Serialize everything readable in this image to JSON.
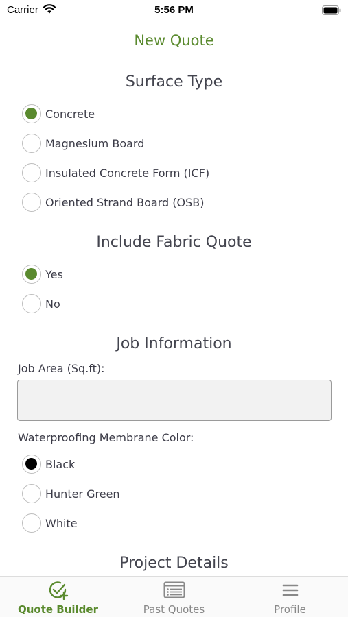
{
  "status_bar": {
    "carrier": "Carrier",
    "time": "5:56 PM"
  },
  "nav": {
    "title": "New Quote"
  },
  "colors": {
    "accent": "#5a8a2e",
    "black_swatch": "#000000"
  },
  "surface_type": {
    "heading": "Surface Type",
    "options": [
      {
        "label": "Concrete",
        "selected": true
      },
      {
        "label": "Magnesium Board",
        "selected": false
      },
      {
        "label": "Insulated Concrete Form (ICF)",
        "selected": false
      },
      {
        "label": "Oriented Strand Board (OSB)",
        "selected": false
      }
    ]
  },
  "fabric_quote": {
    "heading": "Include Fabric Quote",
    "options": [
      {
        "label": "Yes",
        "selected": true
      },
      {
        "label": "No",
        "selected": false
      }
    ]
  },
  "job_info": {
    "heading": "Job Information",
    "job_area_label": "Job Area (Sq.ft):",
    "job_area_value": "",
    "membrane_color_label": "Waterproofing Membrane Color:",
    "membrane_colors": [
      {
        "label": "Black",
        "selected": true
      },
      {
        "label": "Hunter Green",
        "selected": false
      },
      {
        "label": "White",
        "selected": false
      }
    ]
  },
  "project_details": {
    "heading": "Project Details"
  },
  "tab_bar": {
    "tabs": [
      {
        "label": "Quote Builder",
        "icon": "check-plus-icon",
        "active": true
      },
      {
        "label": "Past Quotes",
        "icon": "list-icon",
        "active": false
      },
      {
        "label": "Profile",
        "icon": "menu-icon",
        "active": false
      }
    ]
  }
}
